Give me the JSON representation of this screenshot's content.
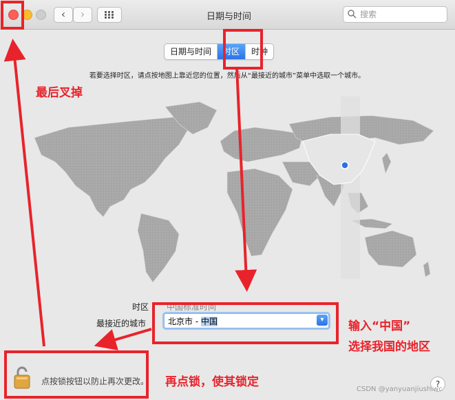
{
  "window": {
    "title": "日期与时间",
    "nav_back": "‹",
    "nav_forward": "›"
  },
  "search": {
    "placeholder": "搜索"
  },
  "tabs": [
    {
      "label": "日期与时间"
    },
    {
      "label": "时区",
      "active": true
    },
    {
      "label": "时钟"
    }
  ],
  "instruction": "若要选择时区，请点按地图上靠近您的位置，然后从“最接近的城市”菜单中选取一个城市。",
  "timezone": {
    "label": "时区",
    "value": "中国标准时间"
  },
  "closest_city": {
    "label": "最接近的城市",
    "value_city": "北京市 - ",
    "value_country": "中国"
  },
  "lock": {
    "text": "点按锁按钮以防止再次更改。"
  },
  "help": "?",
  "annotations": {
    "close_hint": "最后叉掉",
    "input_hint_1": "输入“中国”",
    "input_hint_2": "选择我国的地区",
    "lock_hint": "再点锁，使其锁定"
  },
  "watermark": "CSDN @yanyuanjiushiwc",
  "colors": {
    "accent_blue": "#2a73e6",
    "annotation_red": "#e8232b",
    "map_land": "#a8a8a8",
    "map_highlight": "#e6e6e6"
  }
}
